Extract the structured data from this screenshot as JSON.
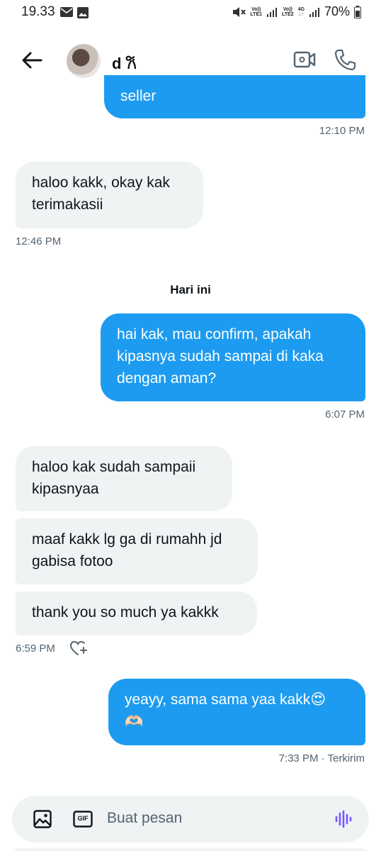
{
  "status_bar": {
    "time": "19.33",
    "net_top_1": "Vo))",
    "net_bottom_1": "LTE1",
    "net_top_2": "Vo))",
    "net_bottom_2": "LTE2",
    "net_4g": "4G",
    "battery": "70%"
  },
  "header": {
    "contact_name": "d 𐙚"
  },
  "messages": [
    {
      "id": "m0",
      "direction": "out",
      "text": "seller"
    },
    {
      "id": "m1",
      "direction": "in",
      "text": "haloo kakk, okay kak\nterimakasii"
    },
    {
      "id": "m2",
      "direction": "out",
      "text": "hai kak, mau confirm, apakah\nkipasnya sudah sampai di kaka\ndengan aman?"
    },
    {
      "id": "m3",
      "direction": "in",
      "text": "haloo kak sudah sampaii\nkipasnyaa"
    },
    {
      "id": "m4",
      "direction": "in",
      "text": "maaf kakk lg ga di rumahh jd\ngabisa fotoo"
    },
    {
      "id": "m5",
      "direction": "in",
      "text": "thank you so much ya kakkk"
    },
    {
      "id": "m6",
      "direction": "out",
      "text": "yeayy, sama sama yaa kakk😍\n🫶🏻"
    }
  ],
  "timestamps": {
    "t0": "12:10 PM",
    "t1": "12:46 PM",
    "t2": "6:07 PM",
    "t3": "6:59 PM",
    "t4": "7:33 PM · Terkirim"
  },
  "day_separator": "Hari ini",
  "composer": {
    "placeholder": "Buat pesan",
    "gif_label": "GIF"
  },
  "icons": {
    "back": "arrow-left-icon",
    "video": "video-call-icon",
    "phone": "phone-icon",
    "react": "heart-plus-icon",
    "image": "image-icon",
    "gif": "gif-icon",
    "voice": "voice-wave-icon"
  },
  "colors": {
    "accent": "#1d9bf0",
    "incoming_bubble": "#eff3f4",
    "muted_text": "#536471",
    "voice_icon": "#7856ff"
  }
}
